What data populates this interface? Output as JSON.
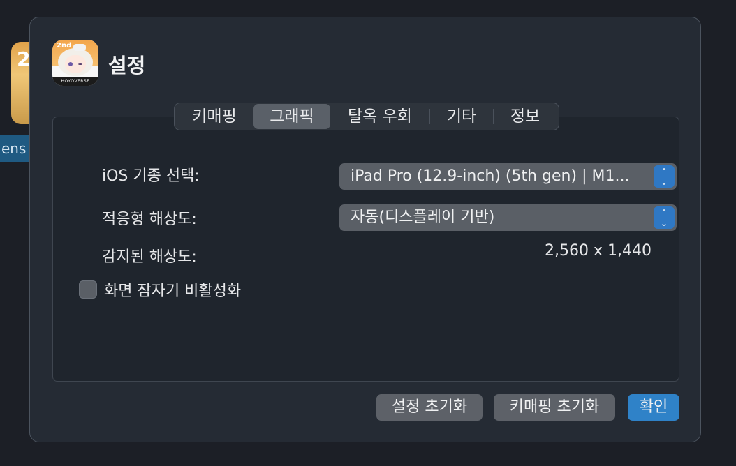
{
  "background": {
    "icon_glyph": "2",
    "label": "ens"
  },
  "dialog": {
    "title": "설정",
    "app_icon_brand": "HOYOVERSE",
    "app_icon_badge": "2nd"
  },
  "tabs": [
    {
      "label": "키매핑",
      "active": false
    },
    {
      "label": "그래픽",
      "active": true
    },
    {
      "label": "탈옥 우회",
      "active": false
    },
    {
      "label": "기타",
      "active": false
    },
    {
      "label": "정보",
      "active": false
    }
  ],
  "graphics": {
    "ios_model_label": "iOS 기종 선택:",
    "ios_model_value": "iPad Pro (12.9-inch) (5th gen) | M1...",
    "adaptive_resolution_label": "적응형 해상도:",
    "adaptive_resolution_value": "자동(디스플레이 기반)",
    "detected_resolution_label": "감지된 해상도:",
    "detected_resolution_value": "2,560 x 1,440",
    "disable_screen_lock_label": "화면 잠자기 비활성화",
    "disable_screen_lock_checked": false
  },
  "buttons": {
    "reset_settings": "설정 초기화",
    "reset_keymapping": "키매핑 초기화",
    "confirm": "확인"
  },
  "colors": {
    "accent": "#2f82c8",
    "dialog_bg": "#252b34",
    "panel_bg": "#1f252d"
  }
}
